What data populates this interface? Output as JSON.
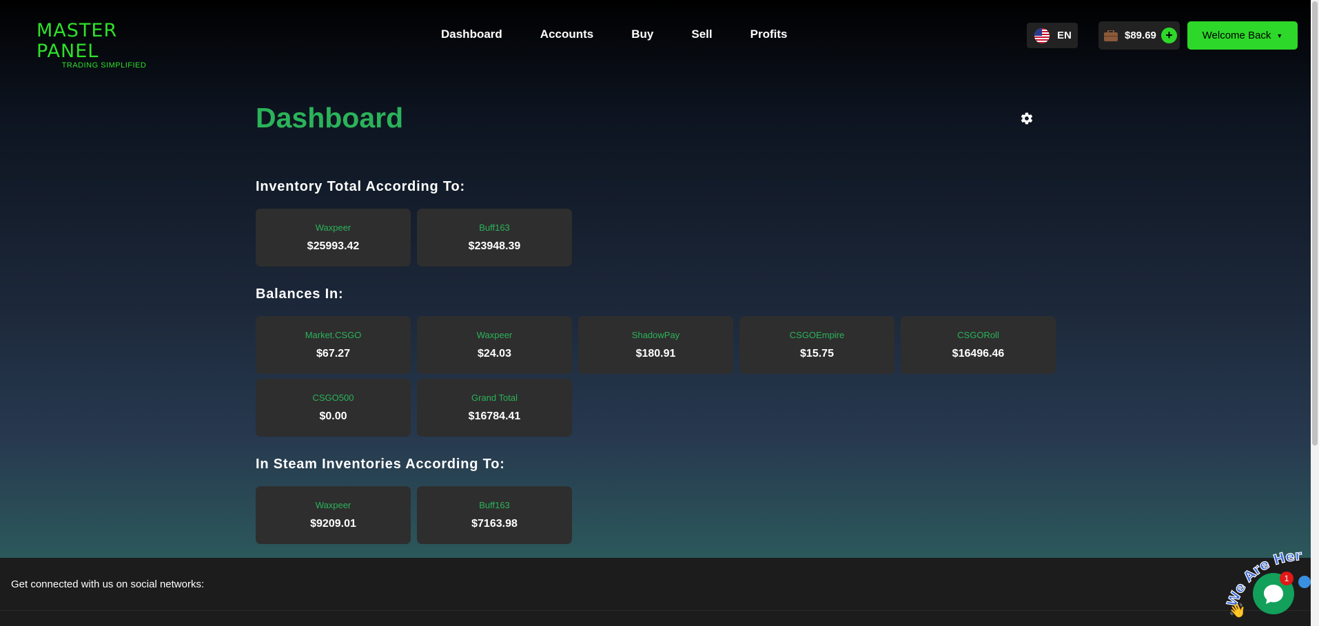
{
  "brand": {
    "name": "MASTER PANEL",
    "tagline": "TRADING SIMPLIFIED",
    "accent_color": "#2ee02a"
  },
  "nav": {
    "links": [
      "Dashboard",
      "Accounts",
      "Buy",
      "Sell",
      "Profits"
    ]
  },
  "language": {
    "label": "EN",
    "icon": "us-flag-icon"
  },
  "wallet": {
    "amount": "$89.69",
    "add_label": "+",
    "icon": "briefcase-icon"
  },
  "user_menu": {
    "label": "Welcome Back",
    "caret": "▼"
  },
  "page": {
    "title": "Dashboard",
    "title_color": "#2bb35a",
    "settings_icon": "gear-icon"
  },
  "sections": {
    "inventory_total": {
      "title": "Inventory Total According To:",
      "cards": [
        {
          "label": "Waxpeer",
          "value": "$25993.42"
        },
        {
          "label": "Buff163",
          "value": "$23948.39"
        }
      ]
    },
    "balances": {
      "title": "Balances In:",
      "cards": [
        {
          "label": "Market.CSGO",
          "value": "$67.27"
        },
        {
          "label": "Waxpeer",
          "value": "$24.03"
        },
        {
          "label": "ShadowPay",
          "value": "$180.91"
        },
        {
          "label": "CSGOEmpire",
          "value": "$15.75"
        },
        {
          "label": "CSGORoll",
          "value": "$16496.46"
        },
        {
          "label": "CSGO500",
          "value": "$0.00"
        },
        {
          "label": "Grand Total",
          "value": "$16784.41"
        }
      ]
    },
    "steam_inventories": {
      "title": "In Steam Inventories According To:",
      "cards": [
        {
          "label": "Waxpeer",
          "value": "$9209.01"
        },
        {
          "label": "Buff163",
          "value": "$7163.98"
        }
      ]
    }
  },
  "footer": {
    "text": "Get connected with us on social networks:"
  },
  "chat_widget": {
    "badge_count": "1",
    "sticker_text": "We Are Here!"
  }
}
